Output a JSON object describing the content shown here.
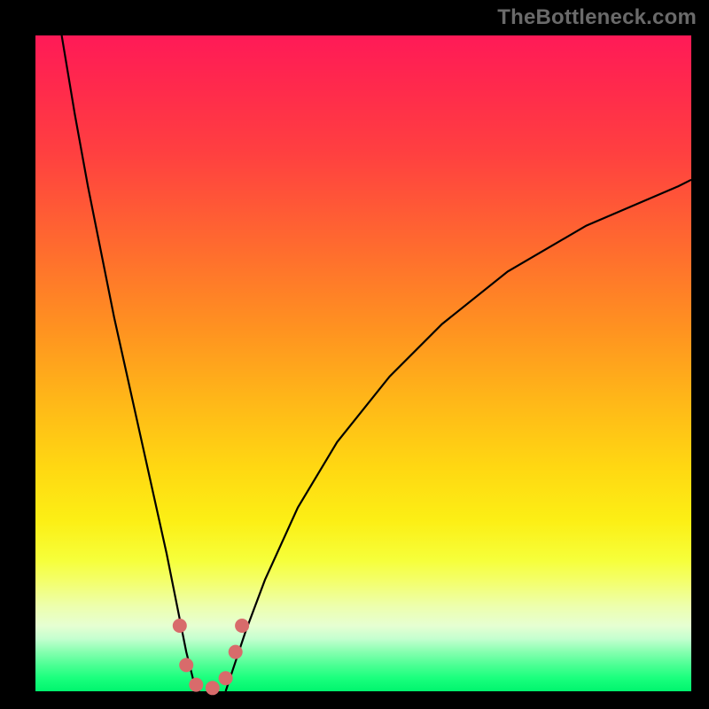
{
  "watermark": "TheBottleneck.com",
  "chart_data": {
    "type": "line",
    "title": "",
    "xlabel": "",
    "ylabel": "",
    "xlim": [
      0,
      100
    ],
    "ylim": [
      0,
      100
    ],
    "series": [
      {
        "name": "left-curve",
        "x": [
          4,
          6,
          8,
          10,
          12,
          14,
          16,
          18,
          20,
          22,
          23,
          24,
          25
        ],
        "y": [
          100,
          88,
          77,
          67,
          57,
          48,
          39,
          30,
          21,
          11,
          6,
          2,
          0
        ]
      },
      {
        "name": "right-curve",
        "x": [
          29,
          30,
          32,
          35,
          40,
          46,
          54,
          62,
          72,
          84,
          98,
          100
        ],
        "y": [
          0,
          3,
          9,
          17,
          28,
          38,
          48,
          56,
          64,
          71,
          77,
          78
        ]
      }
    ],
    "annotations": {
      "optimum_markers": [
        {
          "x": 22.0,
          "y": 10
        },
        {
          "x": 23.0,
          "y": 4
        },
        {
          "x": 24.5,
          "y": 1
        },
        {
          "x": 27.0,
          "y": 0.5
        },
        {
          "x": 29.0,
          "y": 2
        },
        {
          "x": 30.5,
          "y": 6
        },
        {
          "x": 31.5,
          "y": 10
        }
      ]
    },
    "gradient_meaning": "background encodes bottleneck severity: red=high, yellow=mid, green=low"
  },
  "colors": {
    "frame": "#000000",
    "watermark": "#6a6a6a",
    "curve": "#000000",
    "marker": "#d86b6b"
  }
}
